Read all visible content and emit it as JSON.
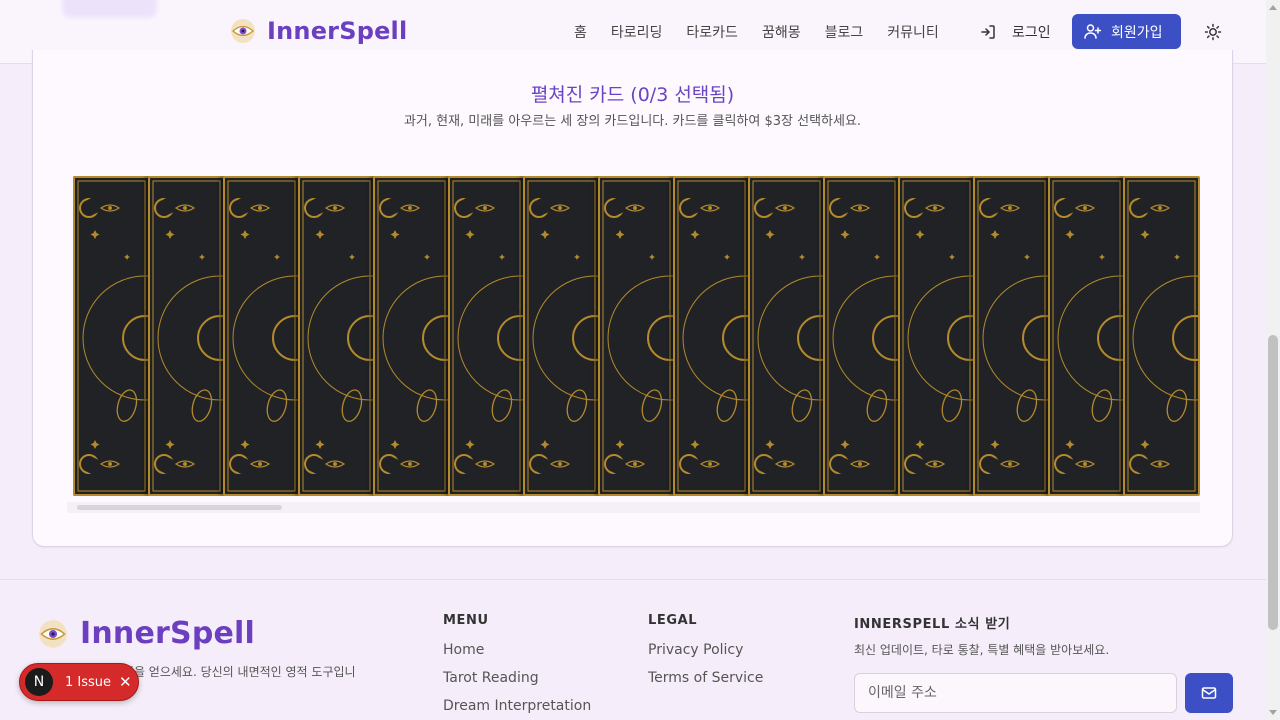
{
  "brand": {
    "name": "InnerSpell"
  },
  "nav": {
    "items": [
      "홈",
      "타로리딩",
      "타로카드",
      "꿈해몽",
      "블로그",
      "커뮤니티"
    ],
    "login_label": "로그인",
    "signup_label": "회원가입"
  },
  "spread": {
    "title": "펼쳐진 카드 (0/3 선택됨)",
    "description": "과거, 현재, 미래를 아우르는 세 장의 카드입니다. 카드를 클릭하여 $3장 선택하세요.",
    "visible_cards": 15,
    "selected": 0,
    "colors": {
      "card_bg": "#202226",
      "gold": "#b38a2c"
    }
  },
  "footer": {
    "tagline": "로 명확성과 통찰력을 얻으세요. 당신의 내면적인 영적 도구입니다.",
    "menu": {
      "title": "MENU",
      "links": [
        "Home",
        "Tarot Reading",
        "Dream Interpretation"
      ]
    },
    "legal": {
      "title": "LEGAL",
      "links": [
        "Privacy Policy",
        "Terms of Service"
      ]
    },
    "newsletter": {
      "title": "INNERSPELL 소식 받기",
      "description": "최신 업데이트, 타로 통찰, 특별 혜택을 받아보세요.",
      "email_placeholder": "이메일 주소"
    }
  },
  "issues_badge": {
    "avatar_letter": "N",
    "label": "1 Issue"
  },
  "colors": {
    "accent": "#6b3fbf",
    "button": "#3d4fc4",
    "background": "#f5eefa"
  }
}
